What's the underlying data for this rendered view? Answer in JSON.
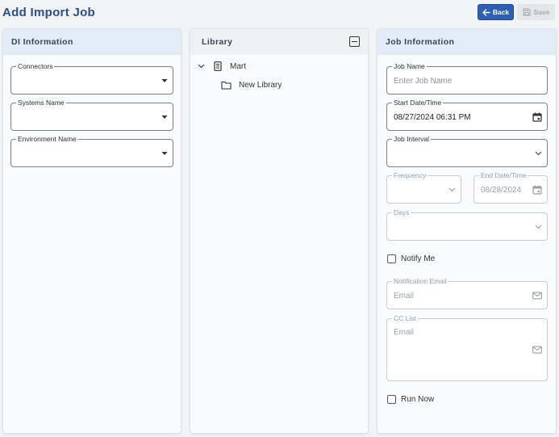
{
  "page": {
    "title": "Add Import Job"
  },
  "toolbar": {
    "back_label": "Back",
    "save_label": "Save"
  },
  "di_panel": {
    "title": "DI Information",
    "connectors_label": "Connectors",
    "systems_label": "Systems Name",
    "environment_label": "Environment Name"
  },
  "library_panel": {
    "title": "Library",
    "tree": [
      {
        "label": "Mart",
        "icon": "document-icon",
        "expanded": true
      },
      {
        "label": "New Library",
        "icon": "folder-icon"
      }
    ]
  },
  "job_panel": {
    "title": "Job Information",
    "job_name": {
      "label": "Job Name",
      "placeholder": "Enter Job Name"
    },
    "start_datetime": {
      "label": "Start Date/Time",
      "value": "08/27/2024 06:31 PM"
    },
    "job_interval": {
      "label": "Job Interval"
    },
    "frequency": {
      "label": "Frequency"
    },
    "end_datetime": {
      "label": "End Date/Time",
      "value": "08/28/2024"
    },
    "days": {
      "label": "Days"
    },
    "notify_me": "Notify Me",
    "notification_email": {
      "label": "Notification Email",
      "placeholder": "Email"
    },
    "cc_list": {
      "label": "CC List",
      "placeholder": "Email"
    },
    "run_now": "Run Now"
  },
  "colors": {
    "accent": "#2d5fb3",
    "title": "#2b4d8c",
    "header_bg": "#e2ecf7"
  }
}
